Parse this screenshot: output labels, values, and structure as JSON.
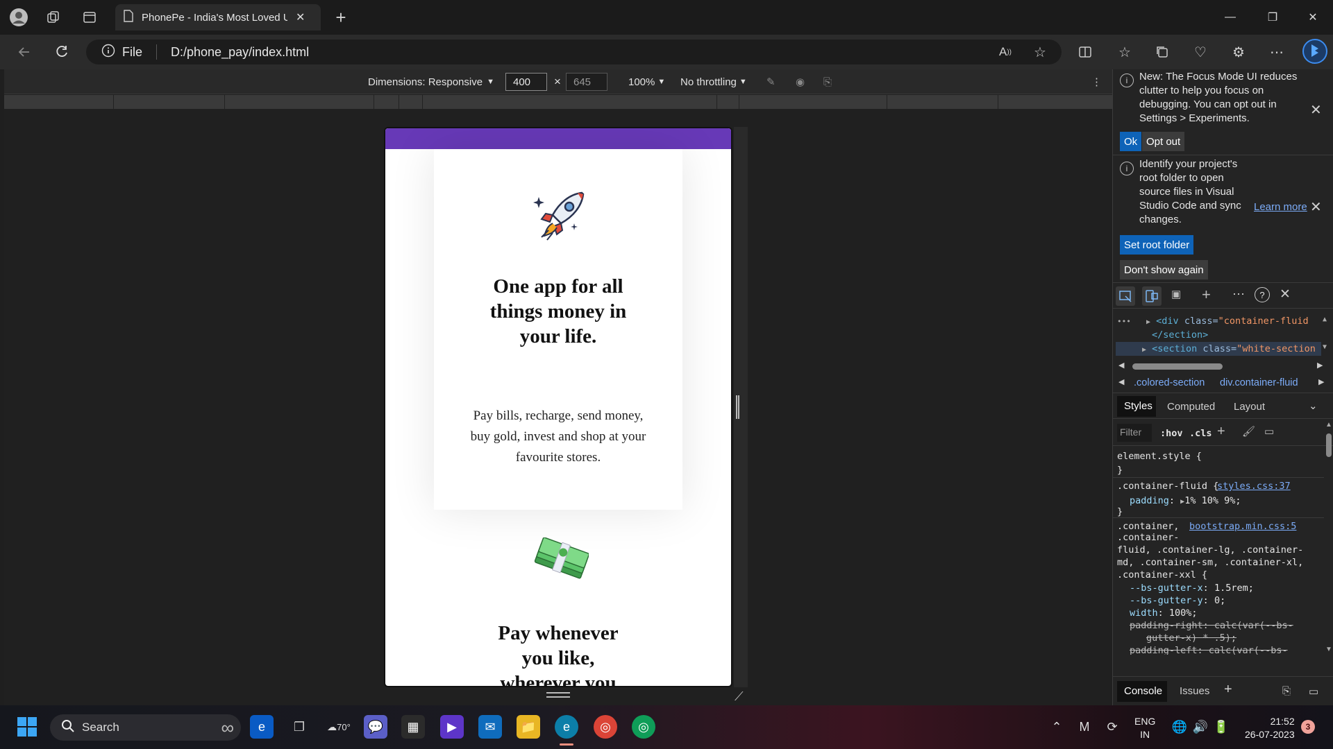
{
  "browser": {
    "tab_title": "PhonePe - India's Most Loved UI",
    "new_tab_symbol": "+",
    "url_scheme": "File",
    "url": "D:/phone_pay/index.html",
    "window_controls": {
      "minimize": "—",
      "restore": "❐",
      "close": "✕"
    }
  },
  "device_toolbar": {
    "dimensions_label": "Dimensions: Responsive",
    "width": "400",
    "height": "645",
    "zoom": "100%",
    "throttling": "No throttling"
  },
  "page": {
    "card1": {
      "heading": "One app for all things money in your life.",
      "body": "Pay bills, recharge, send money, buy gold, invest and shop at your favourite stores."
    },
    "card2": {
      "heading": "Pay whenever you like, wherever you"
    },
    "colors": {
      "brand_purple": "#6739b7"
    }
  },
  "devtools": {
    "notice1": {
      "text": "New: The Focus Mode UI reduces clutter to help you focus on debugging. You can opt out in Settings > Experiments.",
      "ok_label": "Ok",
      "optout_label": "Opt out"
    },
    "notice2": {
      "text": "Identify your project's root folder to open source files in Visual Studio Code and sync changes.",
      "learn_more": "Learn more",
      "set_root_label": "Set root folder",
      "dont_show_label": "Don't show again"
    },
    "dom": {
      "line1_tag_open": "<div ",
      "line1_attr": "class=",
      "line1_val": "\"container-fluid",
      "line2": "</section>",
      "line3_tag_open": "<section ",
      "line3_attr": "class=",
      "line3_val": "\"white-section"
    },
    "breadcrumb": {
      "item1": ".colored-section",
      "item2": "div.container-fluid"
    },
    "tabs": {
      "styles": "Styles",
      "computed": "Computed",
      "layout": "Layout"
    },
    "filter": {
      "placeholder": "Filter",
      "hov": ":hov",
      "cls": ".cls"
    },
    "rules": {
      "r1_selector": "element.style {",
      "r1_close": "}",
      "r2_selector": ".container-fluid {",
      "r2_source": "styles.css:37",
      "r2_prop": "padding",
      "r2_value": "1% 10% 9%;",
      "r2_close": "}",
      "r3_selector_a": ".container,",
      "r3_source": "bootstrap.min.css:5",
      "r3_selector_b": ".container-",
      "r3_selector_c": "fluid, .container-lg, .container-",
      "r3_selector_d": "md, .container-sm, .container-xl,",
      "r3_selector_e": ".container-xxl {",
      "r3_p1": "--bs-gutter-x",
      "r3_v1": "1.5rem;",
      "r3_p2": "--bs-gutter-y",
      "r3_v2": "0;",
      "r3_p3": "width",
      "r3_v3": "100%;",
      "r3_p4": "padding-right: calc(var(--bs-",
      "r3_p4b": "gutter-x) * .5);",
      "r3_p5": "padding-left: calc(var(--bs-"
    },
    "drawer": {
      "console": "Console",
      "issues": "Issues"
    }
  },
  "taskbar": {
    "search_label": "Search",
    "weather_temp": "70°",
    "language": "ENG",
    "region": "IN",
    "time": "21:52",
    "date": "26-07-2023",
    "notification_count": "3"
  }
}
